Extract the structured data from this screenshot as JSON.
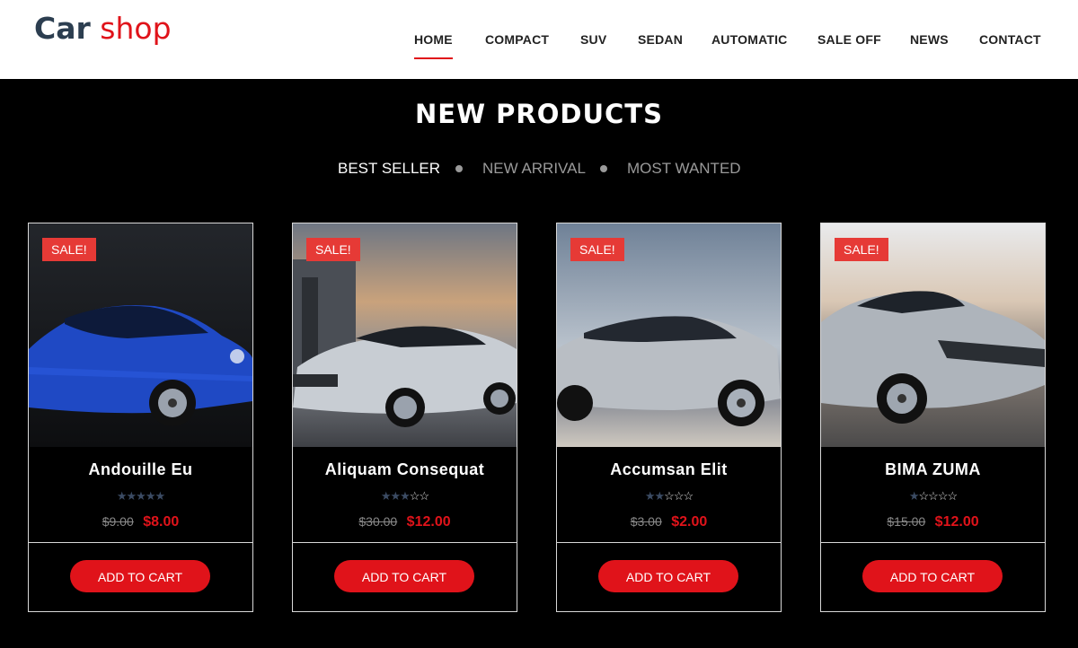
{
  "logo": {
    "part1": "Car",
    "part2": "shop"
  },
  "nav": [
    "HOME",
    "COMPACT",
    "SUV",
    "SEDAN",
    "AUTOMATIC",
    "SALE OFF",
    "NEWS",
    "CONTACT"
  ],
  "section_title": "NEW PRODUCTS",
  "tabs": [
    "BEST SELLER",
    "NEW ARRIVAL",
    "MOST WANTED"
  ],
  "products": [
    {
      "badge": "SALE!",
      "name": "Andouille Eu",
      "rating": 5,
      "old_price": "$9.00",
      "price": "$8.00",
      "button": "ADD TO CART",
      "car_color": "#1f49c4",
      "car_desc": "blue hatchback"
    },
    {
      "badge": "SALE!",
      "name": "Aliquam Consequat",
      "rating": 3,
      "old_price": "$30.00",
      "price": "$12.00",
      "button": "ADD TO CART",
      "car_color": "#c8cdd3",
      "car_desc": "silver sedan"
    },
    {
      "badge": "SALE!",
      "name": "Accumsan Elit",
      "rating": 2,
      "old_price": "$3.00",
      "price": "$2.00",
      "button": "ADD TO CART",
      "car_color": "#b9bec4",
      "car_desc": "silver sedan"
    },
    {
      "badge": "SALE!",
      "name": "BIMA ZUMA",
      "rating": 1,
      "old_price": "$15.00",
      "price": "$12.00",
      "button": "ADD TO CART",
      "car_color": "#aeb4bb",
      "car_desc": "silver sports coupe"
    }
  ],
  "colors": {
    "accent": "#e0131a",
    "logo_dark": "#2c3e50",
    "background": "#000000",
    "sale_badge": "#e63a36",
    "star_filled": "#3b4b63"
  }
}
